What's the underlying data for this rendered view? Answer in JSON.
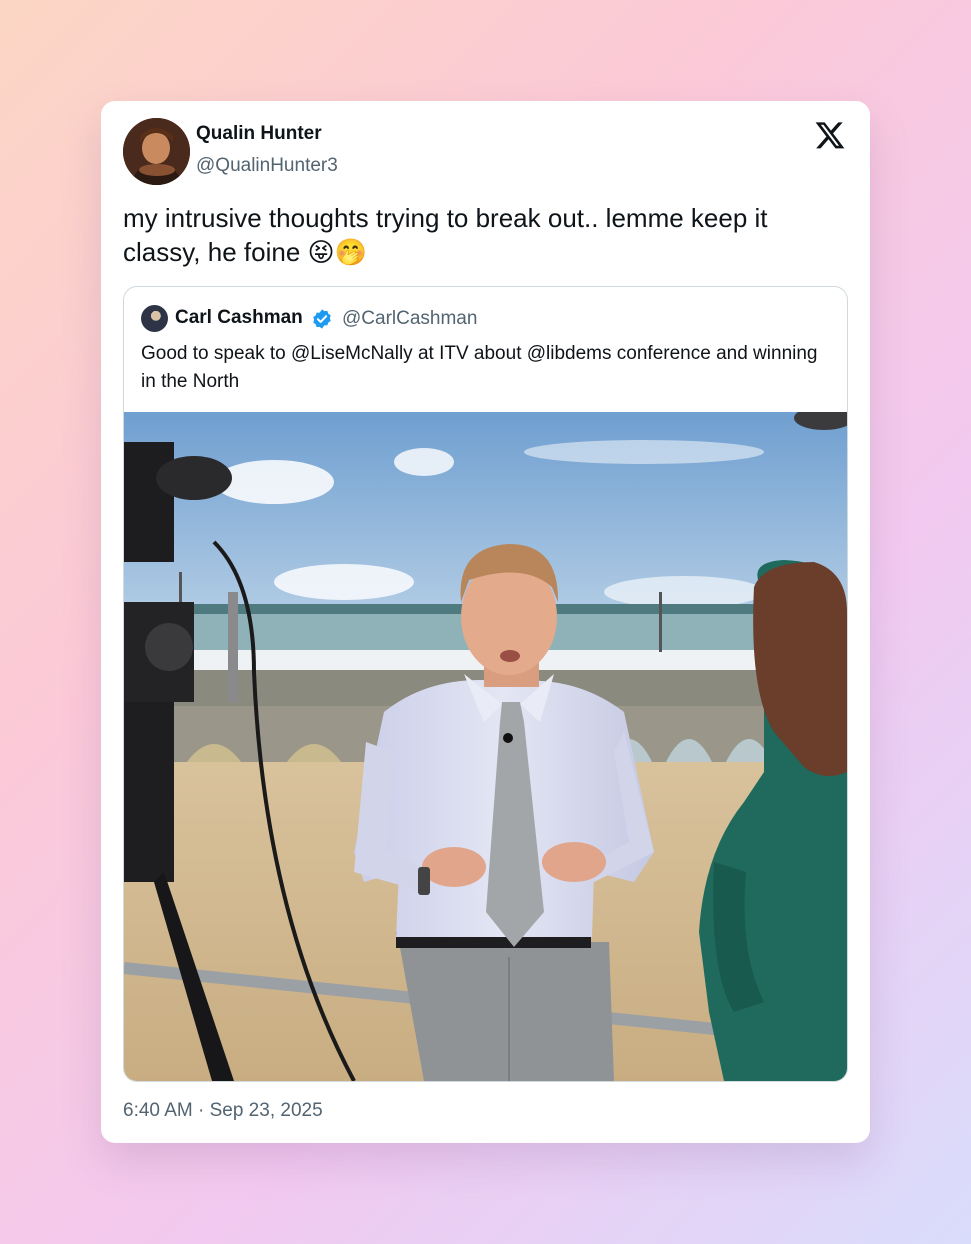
{
  "tweet": {
    "author_name": "Qualin Hunter",
    "author_handle": "@QualinHunter3",
    "text": "my intrusive thoughts trying to break out.. lemme keep it classy, he foine",
    "emojis": [
      "😝",
      "🤭"
    ],
    "timestamp": "6:40 AM · Sep 23, 2025",
    "platform_logo": "x-logo-icon"
  },
  "quoted_tweet": {
    "author_name": "Carl Cashman",
    "author_handle": "@CarlCashman",
    "verified_badge": "verified-badge-icon",
    "badge_color": "#1d9bf0",
    "text": "Good to speak to @LiseMcNally at ITV about @libdems conference and winning in the North",
    "image": "photo of a man in a shirt and grey tie being interviewed on a beach in front of a pier"
  },
  "colors": {
    "text_primary": "#0f1419",
    "text_secondary": "#536471",
    "border": "#cfd9de",
    "card_background": "#ffffff"
  }
}
